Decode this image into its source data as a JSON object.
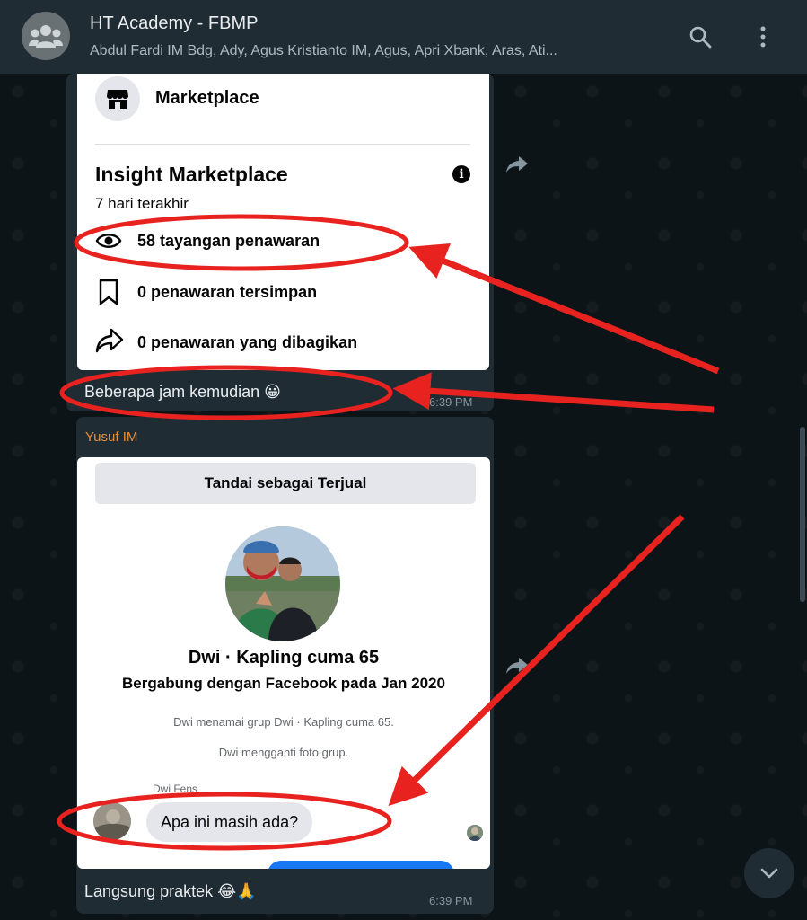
{
  "header": {
    "title": "HT Academy - FBMP",
    "members": "Abdul Fardi IM Bdg, Ady, Agus Kristianto IM, Agus, Apri Xbank, Aras, Ati..."
  },
  "message1": {
    "marketplace_label": "Marketplace",
    "insight_title": "Insight Marketplace",
    "insight_period": "7 hari terakhir",
    "stat_views": "58 tayangan penawaran",
    "stat_saved": "0 penawaran tersimpan",
    "stat_shared": "0 penawaran yang dibagikan",
    "caption": "Beberapa jam kemudian 😀",
    "time": "6:39 PM"
  },
  "message2": {
    "sender": "Yusuf IM",
    "mark_sold_label": "Tandai sebagai Terjual",
    "group_name": "Dwi · Kapling cuma 65",
    "joined_text": "Bergabung dengan Facebook pada Jan 2020",
    "notice1": "Dwi menamai grup Dwi · Kapling cuma 65.",
    "notice2": "Dwi mengganti foto grup.",
    "peek_name": "Dwi Fens",
    "incoming_message": "Apa ini masih ada?",
    "caption": "Langsung praktek 😂🙏",
    "time": "6:39 PM"
  },
  "colors": {
    "header_bg": "#202c33",
    "bubble_bg": "#202c33",
    "sender_name": "#e88f36",
    "annotation_red": "#e8231f",
    "messenger_blue": "#1877f2"
  }
}
